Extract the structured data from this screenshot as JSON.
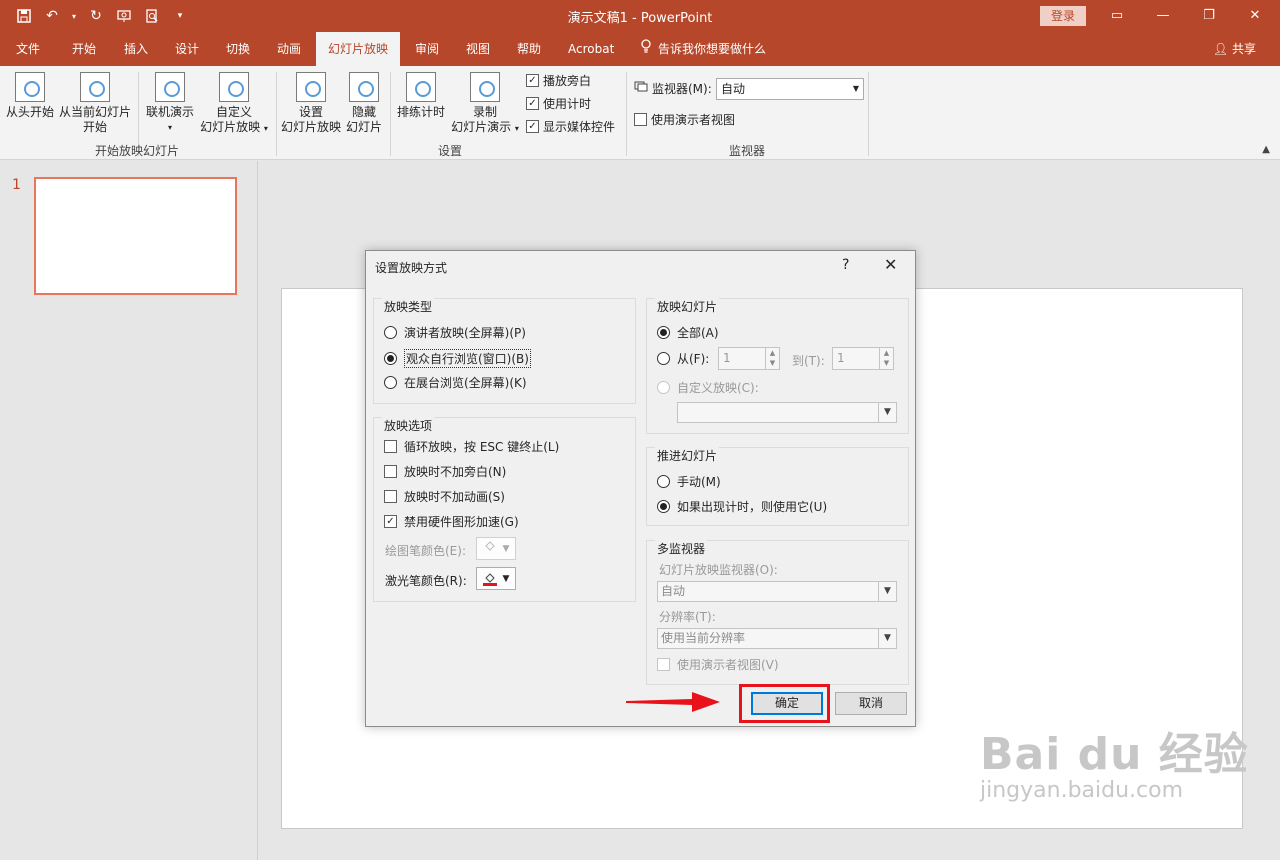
{
  "titlebar": {
    "doc_title": "演示文稿1  -  PowerPoint",
    "login": "登录",
    "icons": [
      "save-icon",
      "undo-icon",
      "redo-icon",
      "present-icon",
      "print-preview-icon",
      "customize-icon"
    ]
  },
  "tabs": [
    {
      "label": "文件"
    },
    {
      "label": "开始"
    },
    {
      "label": "插入"
    },
    {
      "label": "设计"
    },
    {
      "label": "切换"
    },
    {
      "label": "动画"
    },
    {
      "label": "幻灯片放映"
    },
    {
      "label": "审阅"
    },
    {
      "label": "视图"
    },
    {
      "label": "帮助"
    },
    {
      "label": "Acrobat"
    }
  ],
  "tellme": "告诉我你想要做什么",
  "share": "共享",
  "ribbon": {
    "from_start_label": "从头开始",
    "from_current_label1": "从当前幻灯片",
    "from_current_label2": "开始",
    "online_label": "联机演示",
    "custom_label1": "自定义",
    "custom_label2": "幻灯片放映",
    "group1_label": "开始放映幻灯片",
    "setup_label1": "设置",
    "setup_label2": "幻灯片放映",
    "hide_label1": "隐藏",
    "hide_label2": "幻灯片",
    "rehearse_label": "排练计时",
    "record_label1": "录制",
    "record_label2": "幻灯片演示",
    "chk_narration": "播放旁白",
    "chk_timings": "使用计时",
    "chk_media": "显示媒体控件",
    "group2_label": "设置",
    "monitor_label": "监视器(M):",
    "monitor_value": "自动",
    "presenter_view": "使用演示者视图",
    "group3_label": "监视器"
  },
  "slide_pane": {
    "slide_number": "1"
  },
  "dialog": {
    "title": "设置放映方式",
    "help": "?",
    "close": "✕",
    "show_type": {
      "legend": "放映类型",
      "opt1": "演讲者放映(全屏幕)(P)",
      "opt2": "观众自行浏览(窗口)(B)",
      "opt3": "在展台浏览(全屏幕)(K)"
    },
    "show_options": {
      "legend": "放映选项",
      "loop": "循环放映，按 ESC 键终止(L)",
      "no_narration": "放映时不加旁白(N)",
      "no_animation": "放映时不加动画(S)",
      "disable_hw": "禁用硬件图形加速(G)",
      "pen_color": "绘图笔颜色(E):",
      "laser_color": "激光笔颜色(R):"
    },
    "show_slides": {
      "legend": "放映幻灯片",
      "all": "全部(A)",
      "from": "从(F):",
      "from_value": "1",
      "to": "到(T):",
      "to_value": "1",
      "custom": "自定义放映(C):"
    },
    "advance": {
      "legend": "推进幻灯片",
      "manual": "手动(M)",
      "use_timings": "如果出现计时，则使用它(U)"
    },
    "multi_monitor": {
      "legend": "多监视器",
      "monitor_label": "幻灯片放映监视器(O):",
      "monitor_value": "自动",
      "resolution_label": "分辨率(T):",
      "resolution_value": "使用当前分辨率",
      "presenter_view": "使用演示者视图(V)"
    },
    "ok": "确定",
    "cancel": "取消"
  },
  "colors": {
    "brand": "#b7472a",
    "highlight": "#e8121b",
    "laser_red": "#e81123",
    "focus_blue": "#0078d7"
  },
  "watermark": {
    "line1": "Bai du 经验",
    "line2": "jingyan.baidu.com"
  }
}
